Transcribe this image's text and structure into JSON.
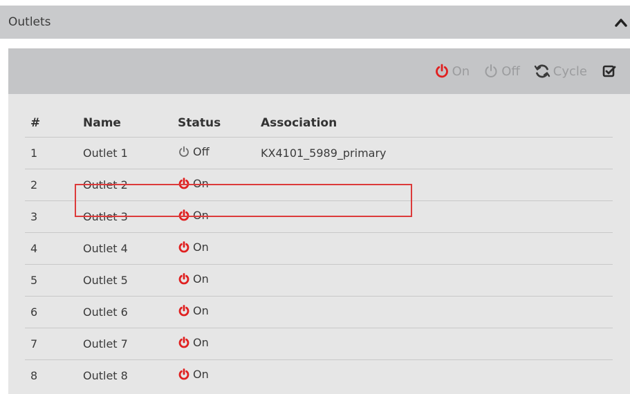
{
  "section": {
    "title": "Outlets",
    "collapse_icon": "chevron-up-icon"
  },
  "toolbar": {
    "on_label": "On",
    "off_label": "Off",
    "cycle_label": "Cycle",
    "on_icon": "power-icon",
    "off_icon": "power-icon",
    "cycle_icon": "refresh-icon",
    "select_all_icon": "checkbox-check-icon",
    "on_color": "#e02020",
    "disabled_color": "#9b9c9e"
  },
  "table": {
    "headers": {
      "num": "#",
      "name": "Name",
      "status": "Status",
      "association": "Association"
    },
    "rows": [
      {
        "num": "1",
        "name": "Outlet 1",
        "status": "Off",
        "association": "KX4101_5989_primary",
        "highlighted": true
      },
      {
        "num": "2",
        "name": "Outlet 2",
        "status": "On",
        "association": ""
      },
      {
        "num": "3",
        "name": "Outlet 3",
        "status": "On",
        "association": ""
      },
      {
        "num": "4",
        "name": "Outlet 4",
        "status": "On",
        "association": ""
      },
      {
        "num": "5",
        "name": "Outlet 5",
        "status": "On",
        "association": ""
      },
      {
        "num": "6",
        "name": "Outlet 6",
        "status": "On",
        "association": ""
      },
      {
        "num": "7",
        "name": "Outlet 7",
        "status": "On",
        "association": ""
      },
      {
        "num": "8",
        "name": "Outlet 8",
        "status": "On",
        "association": ""
      }
    ]
  },
  "colors": {
    "status_on": "#e02020",
    "status_off": "#6b6b6b",
    "highlight": "#dc3a3a"
  }
}
